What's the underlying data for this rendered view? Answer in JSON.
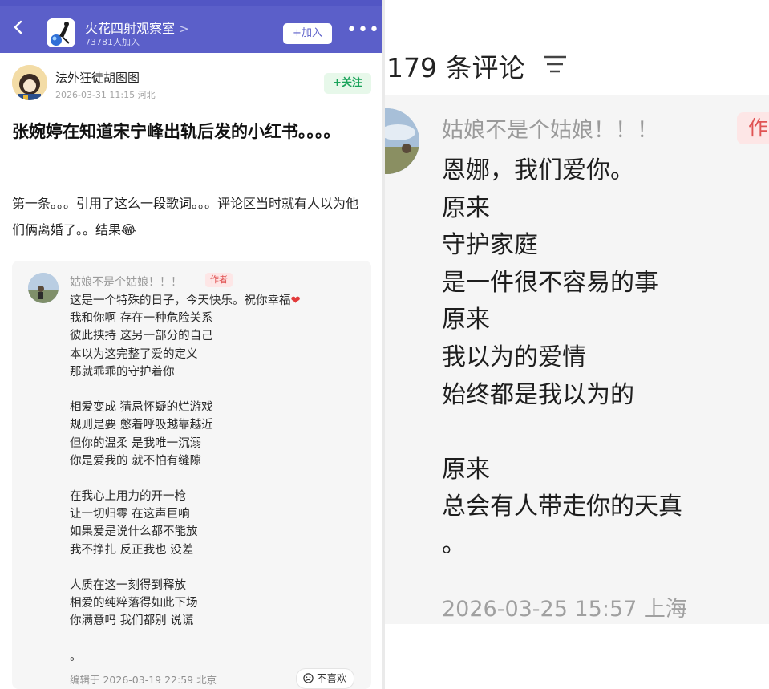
{
  "colors": {
    "topbar": "#5b5fc9",
    "follow_green": "#1aa35a",
    "badge_red": "#e05454",
    "heart": "#e23b3b"
  },
  "topbar": {
    "back_icon": "chevron-left-icon",
    "group_avatar_icon": "group-avatar-image",
    "group_name": "火花四射观察室",
    "group_chevron": ">",
    "members": "73781人加入",
    "join_label": "+加入",
    "more_icon": "more-dots-icon",
    "more_label": "•••"
  },
  "post": {
    "author": "法外狂徒胡图图",
    "meta": "2026-03-31 11:15  河北",
    "follow_label": "+关注",
    "title": "张婉婷在知道宋宁峰出轨后发的小红书。。。。",
    "body": "第一条。。。引用了这么一段歌词。。。评论区当时就有人以为他们俩离婚了。。结果😂"
  },
  "quote": {
    "name": "姑娘不是个姑娘！！！",
    "badge": "作者",
    "first_line": "这是一个特殊的日子，今天快乐。祝你幸福",
    "heart": "❤",
    "lines": [
      "我和你啊 存在一种危险关系",
      "彼此挟持 这另一部分的自己",
      "本以为这完整了爱的定义",
      "那就乖乖的守护着你",
      "",
      "相爱变成 猜忌怀疑的烂游戏",
      "规则是要 憋着呼吸越靠越近",
      "但你的温柔 是我唯一沉溺",
      "你是爱我的 就不怕有缝隙",
      "",
      "在我心上用力的开一枪",
      "让一切归零 在这声巨响",
      "如果爱是说什么都不能放",
      "我不挣扎 反正我也 没差",
      "",
      "人质在这一刻得到释放",
      "相爱的纯粹落得如此下场",
      "你满意吗 我们都别 说谎",
      "",
      "。"
    ],
    "edited": "编辑于  2026-03-19 22:59  北京",
    "dislike_label": "不喜欢",
    "dislike_icon": "sad-face-icon"
  },
  "comments": {
    "header": "179 条评论",
    "sort_icon": "sort-lines-icon",
    "name": "姑娘不是个姑娘！！！",
    "badge": "作",
    "lines": [
      "恩娜，我们爱你。",
      "原来",
      "守护家庭",
      "是一件很不容易的事",
      "原来",
      "我以为的爱情",
      "始终都是我以为的",
      "",
      "原来",
      "总会有人带走你的天真",
      "。"
    ],
    "time": "2026-03-25 15:57  上海"
  }
}
